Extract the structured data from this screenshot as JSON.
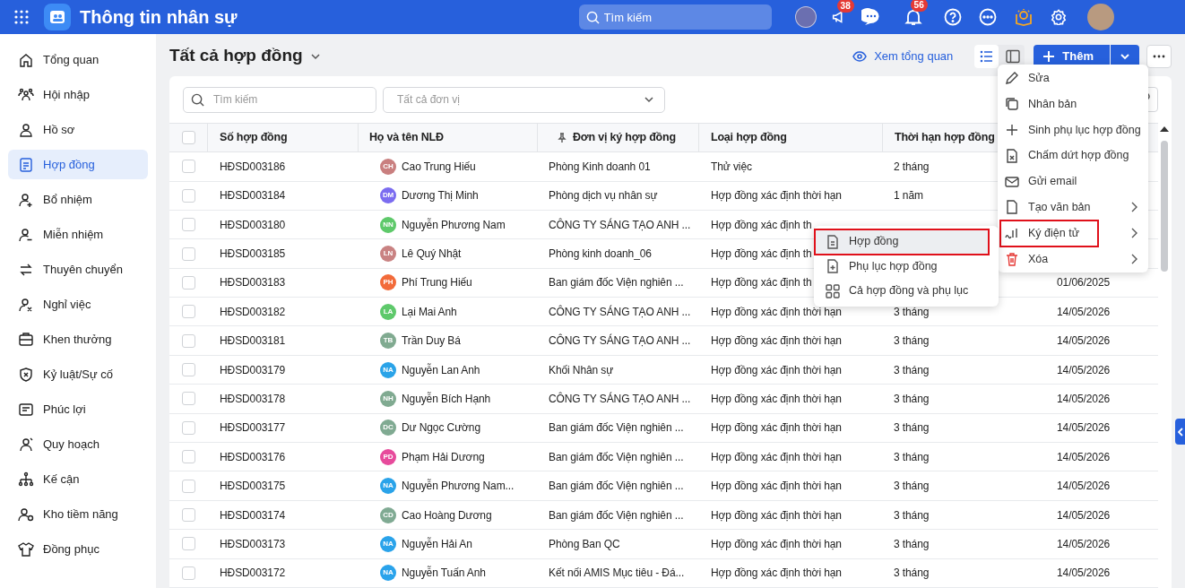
{
  "app": {
    "title": "Thông tin nhân sự",
    "search_placeholder": "Tìm kiếm",
    "badges": [
      {
        "count": "38"
      },
      {
        "count": "56"
      }
    ]
  },
  "sidebar": {
    "items": [
      {
        "label": "Tổng quan",
        "selected": false
      },
      {
        "label": "Hội nhập",
        "selected": false
      },
      {
        "label": "Hồ sơ",
        "selected": false
      },
      {
        "label": "Hợp đồng",
        "selected": true
      },
      {
        "label": "Bổ nhiệm",
        "selected": false
      },
      {
        "label": "Miễn nhiệm",
        "selected": false
      },
      {
        "label": "Thuyên chuyển",
        "selected": false
      },
      {
        "label": "Nghỉ việc",
        "selected": false
      },
      {
        "label": "Khen thưởng",
        "selected": false
      },
      {
        "label": "Kỷ luật/Sự cố",
        "selected": false
      },
      {
        "label": "Phúc lợi",
        "selected": false
      },
      {
        "label": "Quy hoạch",
        "selected": false
      },
      {
        "label": "Kế cận",
        "selected": false
      },
      {
        "label": "Kho tiềm năng",
        "selected": false
      },
      {
        "label": "Đồng phục",
        "selected": false
      }
    ]
  },
  "page": {
    "title": "Tất cả hợp đồng",
    "overview_link": "Xem tổng quan",
    "views": [
      {
        "selected": true
      },
      {
        "selected": false
      }
    ],
    "add_button": "Thêm"
  },
  "filters": {
    "search_placeholder": "Tìm kiếm",
    "unit_placeholder": "Tất cả đơn vị"
  },
  "table": {
    "columns": [
      "Số hợp đồng",
      "Họ và tên NLĐ",
      "Đơn vị ký hợp đồng",
      "Loại hợp đồng",
      "Thời hạn hợp đồng"
    ],
    "all_checked": false,
    "rows": [
      {
        "checked": false,
        "number": "HĐSD003186",
        "initials": "CH",
        "color": "#c97f7f",
        "name": "Cao Trung Hiếu",
        "unit": "Phòng Kinh doanh 01",
        "type": "Thử việc",
        "duration": "2 tháng"
      },
      {
        "checked": false,
        "number": "HĐSD003184",
        "initials": "DM",
        "color": "#7b6cf0",
        "name": "Dương Thị Minh",
        "unit": "Phòng dịch vụ nhân sự",
        "type": "Hợp đồng xác định thời hạn",
        "duration": "1 năm"
      },
      {
        "checked": false,
        "number": "HĐSD003180",
        "initials": "NN",
        "color": "#5ec96a",
        "name": "Nguyễn Phương Nam",
        "unit": "CÔNG TY SÁNG TẠO ANH ...",
        "type": "Hợp đồng xác định th"
      },
      {
        "checked": false,
        "number": "HĐSD003185",
        "initials": "LN",
        "color": "#c98282",
        "name": "Lê Quý Nhật",
        "unit": "Phòng kinh doanh_06",
        "type": "Hợp đồng xác định th"
      },
      {
        "checked": false,
        "number": "HĐSD003183",
        "initials": "PH",
        "color": "#f26b3a",
        "name": "Phí Trung Hiếu",
        "unit": "Ban giám đốc Viện nghiên ...",
        "type": "Hợp đồng xác định th",
        "column_6": "01/06/2025"
      },
      {
        "checked": false,
        "number": "HĐSD003182",
        "initials": "LA",
        "color": "#5ec96b",
        "name": "Lại Mai Anh",
        "unit": "CÔNG TY SÁNG TẠO ANH ...",
        "type": "Hợp đồng xác định thời hạn",
        "duration": "3 tháng",
        "column_6": "14/05/2026"
      },
      {
        "checked": false,
        "number": "HĐSD003181",
        "initials": "TB",
        "color": "#80aa90",
        "name": "Trần Duy Bá",
        "unit": "CÔNG TY SÁNG TẠO ANH ...",
        "type": "Hợp đồng xác định thời hạn",
        "duration": "3 tháng",
        "column_6": "14/05/2026"
      },
      {
        "checked": false,
        "number": "HĐSD003179",
        "initials": "NA",
        "color": "#2aa3e8",
        "name": "Nguyễn Lan Anh",
        "unit": "Khối Nhân sự",
        "type": "Hợp đồng xác định thời hạn",
        "duration": "3 tháng",
        "column_6": "14/05/2026"
      },
      {
        "checked": false,
        "number": "HĐSD003178",
        "initials": "NH",
        "color": "#80aa91",
        "name": "Nguyễn Bích Hạnh",
        "unit": "CÔNG TY SÁNG TẠO ANH ...",
        "type": "Hợp đồng xác định thời hạn",
        "duration": "3 tháng",
        "column_6": "14/05/2026"
      },
      {
        "checked": false,
        "number": "HĐSD003177",
        "initials": "DC",
        "color": "#80aa92",
        "name": "Dư Ngọc Cường",
        "unit": "Ban giám đốc Viện nghiên ...",
        "type": "Hợp đồng xác định thời hạn",
        "duration": "3 tháng",
        "column_6": "14/05/2026"
      },
      {
        "checked": false,
        "number": "HĐSD003176",
        "initials": "PD",
        "color": "#e74b9c",
        "name": "Phạm Hải Dương",
        "unit": "Ban giám đốc Viện nghiên ...",
        "type": "Hợp đồng xác định thời hạn",
        "duration": "3 tháng",
        "column_6": "14/05/2026"
      },
      {
        "checked": false,
        "number": "HĐSD003175",
        "initials": "NA",
        "color": "#2aa3e9",
        "name": "Nguyễn Phương Nam...",
        "unit": "Ban giám đốc Viện nghiên ...",
        "type": "Hợp đồng xác định thời hạn",
        "duration": "3 tháng",
        "column_6": "14/05/2026"
      },
      {
        "checked": false,
        "number": "HĐSD003174",
        "initials": "CD",
        "color": "#80aa93",
        "name": "Cao Hoàng Dương",
        "unit": "Ban giám đốc Viện nghiên ...",
        "type": "Hợp đồng xác định thời hạn",
        "duration": "3 tháng",
        "column_6": "14/05/2026"
      },
      {
        "checked": false,
        "number": "HĐSD003173",
        "initials": "NA",
        "color": "#2aa3ea",
        "name": "Nguyễn Hải An",
        "unit": "Phòng Ban QC",
        "type": "Hợp đồng xác định thời hạn",
        "duration": "3 tháng",
        "column_6": "14/05/2026"
      },
      {
        "checked": false,
        "number": "HĐSD003172",
        "initials": "NA",
        "color": "#2aa3eb",
        "name": "Nguyễn Tuấn Anh",
        "unit": "Kết nối AMIS Mục tiêu - Đá...",
        "type": "Hợp đồng xác định thời hạn",
        "duration": "3 tháng",
        "column_6": "14/05/2026"
      }
    ]
  },
  "context_menu": {
    "items": [
      {
        "label": "Sửa",
        "submenu": false,
        "danger": false,
        "highlighted": false
      },
      {
        "label": "Nhân bản",
        "submenu": false,
        "danger": false,
        "highlighted": false
      },
      {
        "label": "Sinh phụ lục hợp đồng",
        "submenu": false,
        "danger": false,
        "highlighted": false
      },
      {
        "label": "Chấm dứt hợp đồng",
        "submenu": false,
        "danger": false,
        "highlighted": false
      },
      {
        "label": "Gửi email",
        "submenu": false,
        "danger": false,
        "highlighted": false
      },
      {
        "label": "Tạo văn bản",
        "submenu": true,
        "danger": false,
        "highlighted": false
      },
      {
        "label": "Ký điện tử",
        "submenu": true,
        "danger": false,
        "highlighted": true
      },
      {
        "label": "Xóa",
        "submenu": true,
        "danger": true,
        "highlighted": false
      }
    ]
  },
  "submenu": {
    "items": [
      {
        "label": "Hợp đồng",
        "highlighted": true
      },
      {
        "label": "Phụ lục hợp đồng",
        "highlighted": false
      },
      {
        "label": "Cả hợp đồng và phụ lục",
        "highlighted": false
      }
    ]
  }
}
